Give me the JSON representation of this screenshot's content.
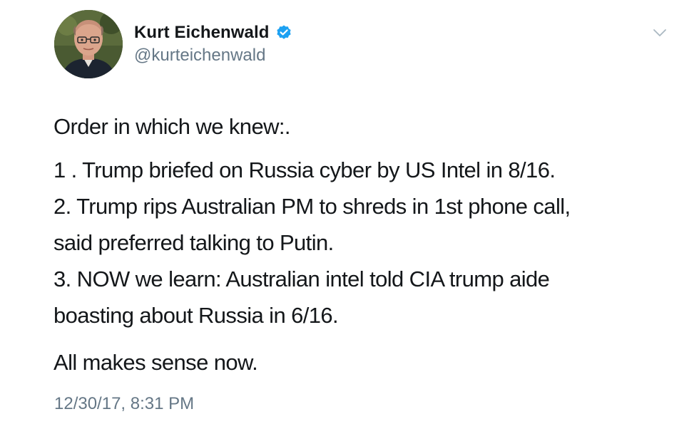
{
  "author": {
    "name": "Kurt Eichenwald",
    "handle": "@kurteichenwald",
    "verified": true,
    "avatar_icon": "profile-photo"
  },
  "tweet": {
    "intro": "Order in which we knew:.",
    "lines": [
      "1 . Trump briefed on Russia cyber by US Intel in 8/16.",
      "2. Trump rips Australian PM to shreds in 1st phone call,",
      "said preferred talking to Putin.",
      "3. NOW we learn: Australian intel told CIA trump aide",
      "boasting about Russia in 6/16."
    ],
    "closing": "All makes sense now.",
    "timestamp": "12/30/17, 8:31 PM"
  },
  "menu": {
    "icon": "chevron-down-icon"
  },
  "colors": {
    "text": "#14171a",
    "secondary": "#657786",
    "verified_badge": "#1da1f2",
    "chevron": "#aab8c2"
  }
}
